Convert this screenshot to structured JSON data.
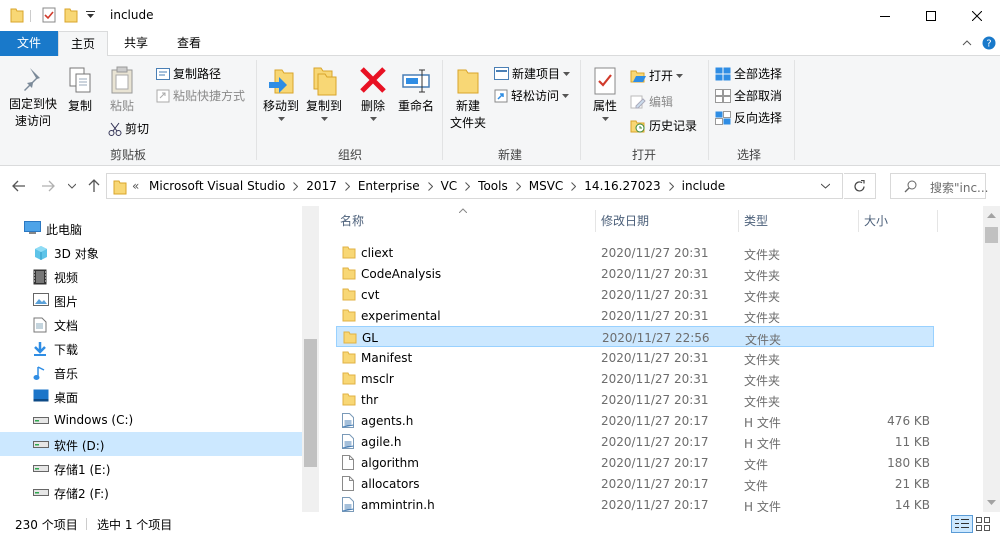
{
  "window": {
    "title": "include"
  },
  "ribbon_tabs": [
    {
      "label": "文件"
    },
    {
      "label": "主页"
    },
    {
      "label": "共享"
    },
    {
      "label": "查看"
    }
  ],
  "ribbon": {
    "clipboard": {
      "pin_label_1": "固定到快",
      "pin_label_2": "速访问",
      "copy": "复制",
      "paste": "粘贴",
      "copy_path": "复制路径",
      "paste_shortcut": "粘贴快捷方式",
      "cut": "剪切",
      "group": "剪贴板"
    },
    "organize": {
      "move_to": "移动到",
      "copy_to": "复制到",
      "delete": "删除",
      "rename": "重命名",
      "group": "组织"
    },
    "new": {
      "new_folder_1": "新建",
      "new_folder_2": "文件夹",
      "new_item": "新建项目",
      "easy_access": "轻松访问",
      "group": "新建"
    },
    "open": {
      "properties": "属性",
      "open": "打开",
      "edit": "编辑",
      "history": "历史记录",
      "group": "打开"
    },
    "select": {
      "select_all": "全部选择",
      "select_none": "全部取消",
      "invert": "反向选择",
      "group": "选择"
    }
  },
  "address": {
    "overflow": "«",
    "crumbs": [
      "Microsoft Visual Studio",
      "2017",
      "Enterprise",
      "VC",
      "Tools",
      "MSVC",
      "14.16.27023",
      "include"
    ],
    "search_placeholder": "搜索\"inc..."
  },
  "nav_pane": {
    "root": "此电脑",
    "items": [
      {
        "label": "3D 对象",
        "icon": "3d-objects-icon"
      },
      {
        "label": "视频",
        "icon": "video-icon"
      },
      {
        "label": "图片",
        "icon": "pictures-icon"
      },
      {
        "label": "文档",
        "icon": "documents-icon"
      },
      {
        "label": "下载",
        "icon": "download-icon"
      },
      {
        "label": "音乐",
        "icon": "music-icon"
      },
      {
        "label": "桌面",
        "icon": "desktop-icon"
      },
      {
        "label": "Windows (C:)",
        "icon": "drive-icon"
      },
      {
        "label": "软件 (D:)",
        "icon": "drive-icon",
        "selected": true
      },
      {
        "label": "存储1 (E:)",
        "icon": "drive-icon"
      },
      {
        "label": "存储2 (F:)",
        "icon": "drive-icon"
      }
    ]
  },
  "columns": {
    "name": "名称",
    "date": "修改日期",
    "type": "类型",
    "size": "大小"
  },
  "files": [
    {
      "name": "cliext",
      "date": "2020/11/27 20:31",
      "type": "文件夹",
      "size": "",
      "kind": "folder"
    },
    {
      "name": "CodeAnalysis",
      "date": "2020/11/27 20:31",
      "type": "文件夹",
      "size": "",
      "kind": "folder"
    },
    {
      "name": "cvt",
      "date": "2020/11/27 20:31",
      "type": "文件夹",
      "size": "",
      "kind": "folder"
    },
    {
      "name": "experimental",
      "date": "2020/11/27 20:31",
      "type": "文件夹",
      "size": "",
      "kind": "folder"
    },
    {
      "name": "GL",
      "date": "2020/11/27 22:56",
      "type": "文件夹",
      "size": "",
      "kind": "folder",
      "selected": true
    },
    {
      "name": "Manifest",
      "date": "2020/11/27 20:31",
      "type": "文件夹",
      "size": "",
      "kind": "folder"
    },
    {
      "name": "msclr",
      "date": "2020/11/27 20:31",
      "type": "文件夹",
      "size": "",
      "kind": "folder"
    },
    {
      "name": "thr",
      "date": "2020/11/27 20:31",
      "type": "文件夹",
      "size": "",
      "kind": "folder"
    },
    {
      "name": "agents.h",
      "date": "2020/11/27 20:17",
      "type": "H 文件",
      "size": "476 KB",
      "kind": "h"
    },
    {
      "name": "agile.h",
      "date": "2020/11/27 20:17",
      "type": "H 文件",
      "size": "11 KB",
      "kind": "h"
    },
    {
      "name": "algorithm",
      "date": "2020/11/27 20:17",
      "type": "文件",
      "size": "180 KB",
      "kind": "file"
    },
    {
      "name": "allocators",
      "date": "2020/11/27 20:17",
      "type": "文件",
      "size": "21 KB",
      "kind": "file"
    },
    {
      "name": "ammintrin.h",
      "date": "2020/11/27 20:17",
      "type": "H 文件",
      "size": "14 KB",
      "kind": "h"
    }
  ],
  "status": {
    "count": "230 个项目",
    "selected": "选中 1 个项目"
  },
  "colors": {
    "accent": "#1979ca",
    "selection": "#cce8ff",
    "folder": "#f8d775"
  }
}
